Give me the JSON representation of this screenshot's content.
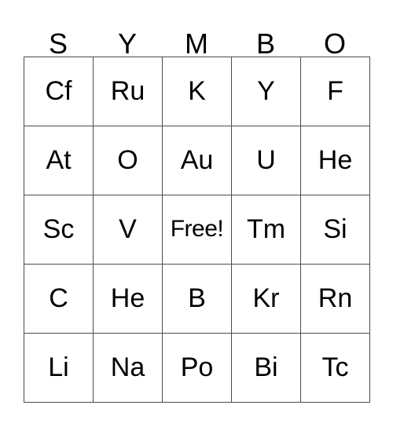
{
  "card": {
    "title_letters": [
      "S",
      "Y",
      "M",
      "B",
      "O"
    ],
    "free_label": "Free!",
    "border_color": "#4d4d4d",
    "text_color": "#000000",
    "background_color": "#ffffff",
    "rows": [
      [
        "Cf",
        "Ru",
        "K",
        "Y",
        "F"
      ],
      [
        "At",
        "O",
        "Au",
        "U",
        "He"
      ],
      [
        "Sc",
        "V",
        "Free!",
        "Tm",
        "Si"
      ],
      [
        "C",
        "He",
        "B",
        "Kr",
        "Rn"
      ],
      [
        "Li",
        "Na",
        "Po",
        "Bi",
        "Tc"
      ]
    ]
  }
}
